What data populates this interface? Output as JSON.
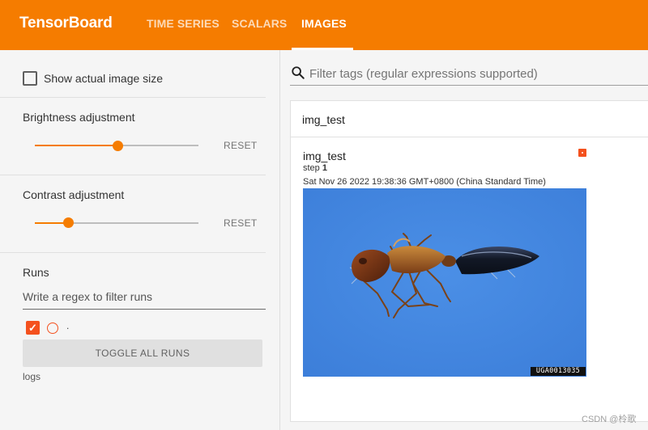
{
  "header": {
    "brand": "TensorBoard",
    "tabs": [
      {
        "label": "TIME SERIES",
        "active": false
      },
      {
        "label": "SCALARS",
        "active": false
      },
      {
        "label": "IMAGES",
        "active": true
      }
    ],
    "accent_color": "#f57c00"
  },
  "sidebar": {
    "show_actual_size": {
      "label": "Show actual image size",
      "checked": false
    },
    "brightness": {
      "label": "Brightness adjustment",
      "value": 0.5,
      "reset_label": "RESET"
    },
    "contrast": {
      "label": "Contrast adjustment",
      "value": 0.2,
      "reset_label": "RESET"
    },
    "runs": {
      "title": "Runs",
      "filter_placeholder": "Write a regex to filter runs",
      "items": [
        {
          "name": ".",
          "checked": true,
          "color": "#f4511e"
        }
      ],
      "toggle_label": "TOGGLE ALL RUNS",
      "logdir": "logs"
    }
  },
  "main": {
    "filter_placeholder": "Filter tags (regular expressions supported)",
    "group": {
      "title": "img_test"
    },
    "card": {
      "tag": "img_test",
      "step_label": "step",
      "step_value": "1",
      "timestamp": "Sat Nov 26 2022 19:38:36 GMT+0800 (China Standard Time)",
      "image_watermark": "UGA0013035"
    }
  },
  "footer_credit": "CSDN @柃歌"
}
